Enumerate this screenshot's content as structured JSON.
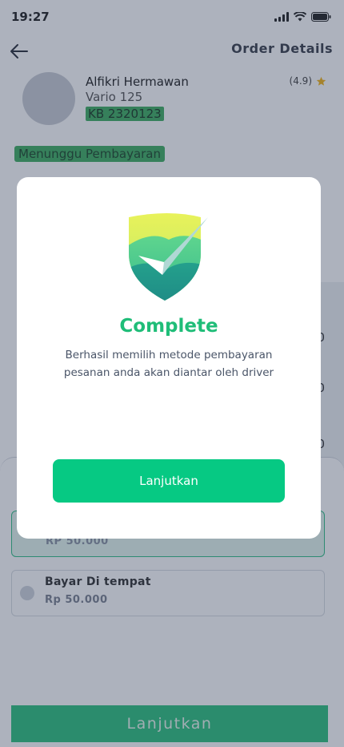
{
  "status_bar": {
    "time": "19:27"
  },
  "header": {
    "title": "Order Details",
    "back_icon": "arrow-left-icon"
  },
  "driver": {
    "name": "Alfikri Hermawan",
    "vehicle": "Vario 125",
    "plate": "KB 2320123",
    "rating": "(4.9)"
  },
  "order_status": "Menunggu Pembayaran",
  "background_values": [
    "0",
    "0",
    "0"
  ],
  "payment_options": [
    {
      "title": "",
      "price": "RP 50.000"
    },
    {
      "title": "Bayar Di tempat",
      "price": "Rp 50.000"
    }
  ],
  "bottom_button": "Lanjutkan",
  "modal": {
    "icon": "shield-check-icon",
    "title": "Complete",
    "message": "Berhasil memilih metode pembayaran pesanan anda akan diantar oleh driver",
    "button": "Lanjutkan"
  },
  "colors": {
    "accent": "#06c983",
    "title_green": "#1fbd78",
    "overlay": "rgba(40,52,82,0.38)"
  }
}
